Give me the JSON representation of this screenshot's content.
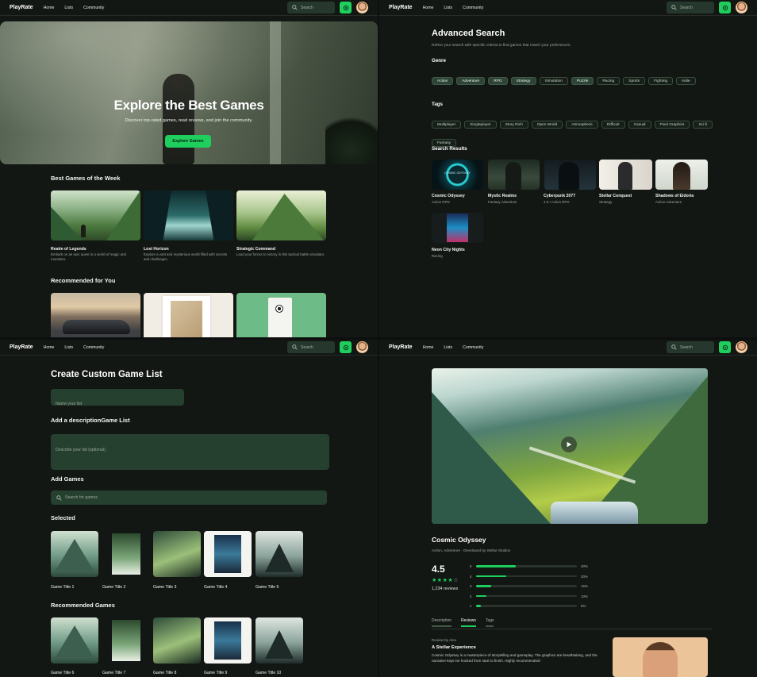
{
  "nav": {
    "brand": "PlayRate",
    "home": "Home",
    "lists": "Lists",
    "community": "Community",
    "search_placeholder": "Search"
  },
  "home": {
    "hero_title": "Explore the Best Games",
    "hero_subtitle": "Discover top-rated games, read reviews, and join the community.",
    "hero_button": "Explore Games",
    "best_heading": "Best Games of the Week",
    "best_games": [
      {
        "title": "Realm of Legends",
        "desc": "Embark on an epic quest in a world of magic and monsters."
      },
      {
        "title": "Lost Horizon",
        "desc": "Explore a vast and mysterious world filled with secrets and challenges."
      },
      {
        "title": "Strategic Command",
        "desc": "Lead your forces to victory in this tactical battle simulator."
      }
    ],
    "recommended_heading": "Recommended for You"
  },
  "advanced": {
    "title": "Advanced Search",
    "subtitle": "Refine your search with specific criteria to find games that match your preferences.",
    "genre_label": "Genre",
    "genres": [
      "Action",
      "Adventure",
      "RPG",
      "Strategy",
      "Simulation",
      "Puzzle",
      "Racing",
      "Sports",
      "Fighting",
      "Indie"
    ],
    "tags_label": "Tags",
    "tags": [
      "Multiplayer",
      "Singleplayer",
      "Story Rich",
      "Open World",
      "Atmospheric",
      "Difficult",
      "Casual",
      "Pixel Graphics",
      "Sci-fi",
      "Fantasy"
    ],
    "results_label": "Search Results",
    "results": [
      {
        "title": "Cosmic Odyssey",
        "sub": "Action RPG",
        "art": "COSMIC ODYSSEY"
      },
      {
        "title": "Mystic Realms",
        "sub": "Fantasy Adventure"
      },
      {
        "title": "Cyberpunk 2077",
        "sub": "4.5 • Action RPG"
      },
      {
        "title": "Stellar Conquest",
        "sub": "Strategy"
      },
      {
        "title": "Shadows of Eldoria",
        "sub": "Action Adventure"
      },
      {
        "title": "Neon City Nights",
        "sub": "Racing"
      }
    ]
  },
  "create": {
    "title": "Create Custom Game List",
    "name_placeholder": "Name your list",
    "desc_heading": "Add a descriptionGame List",
    "desc_placeholder": "Describe your list (optional)",
    "add_heading": "Add Games",
    "search_placeholder": "Search for games",
    "selected_heading": "Selected",
    "selected": [
      "Game Title 1",
      "Game Title 2",
      "Game Title 3",
      "Game Title 4",
      "Game Title 5"
    ],
    "recommended_heading": "Recommended Games",
    "recommended": [
      "Game Title 6",
      "Game Title 7",
      "Game Title 8",
      "Game Title 9",
      "Game Title 10"
    ]
  },
  "detail": {
    "title": "Cosmic Odyssey",
    "meta": "Action, Adventure · Developed by Stellar Studios",
    "rating": "4.5",
    "stars": 4.5,
    "reviews_count": "1,234 reviews",
    "breakdown": [
      {
        "star": "5",
        "pct": "40%",
        "value": 0.4
      },
      {
        "star": "4",
        "pct": "30%",
        "value": 0.3
      },
      {
        "star": "3",
        "pct": "15%",
        "value": 0.15
      },
      {
        "star": "2",
        "pct": "10%",
        "value": 0.1
      },
      {
        "star": "1",
        "pct": "5%",
        "value": 0.05
      }
    ],
    "tabs": [
      "Description",
      "Reviews",
      "Tags"
    ],
    "active_tab": "Reviews",
    "review_by": "Review by Alex",
    "review_title": "A Stellar Experience",
    "review_text": "Cosmic Odyssey is a masterpiece of storytelling and gameplay. The graphics are breathtaking, and the narrative kept me hooked from start to finish. Highly recommended!"
  },
  "colors": {
    "accent": "#1fcf5e",
    "bg": "#131714",
    "field": "#26402f",
    "chip_sel": "#2d4436"
  }
}
